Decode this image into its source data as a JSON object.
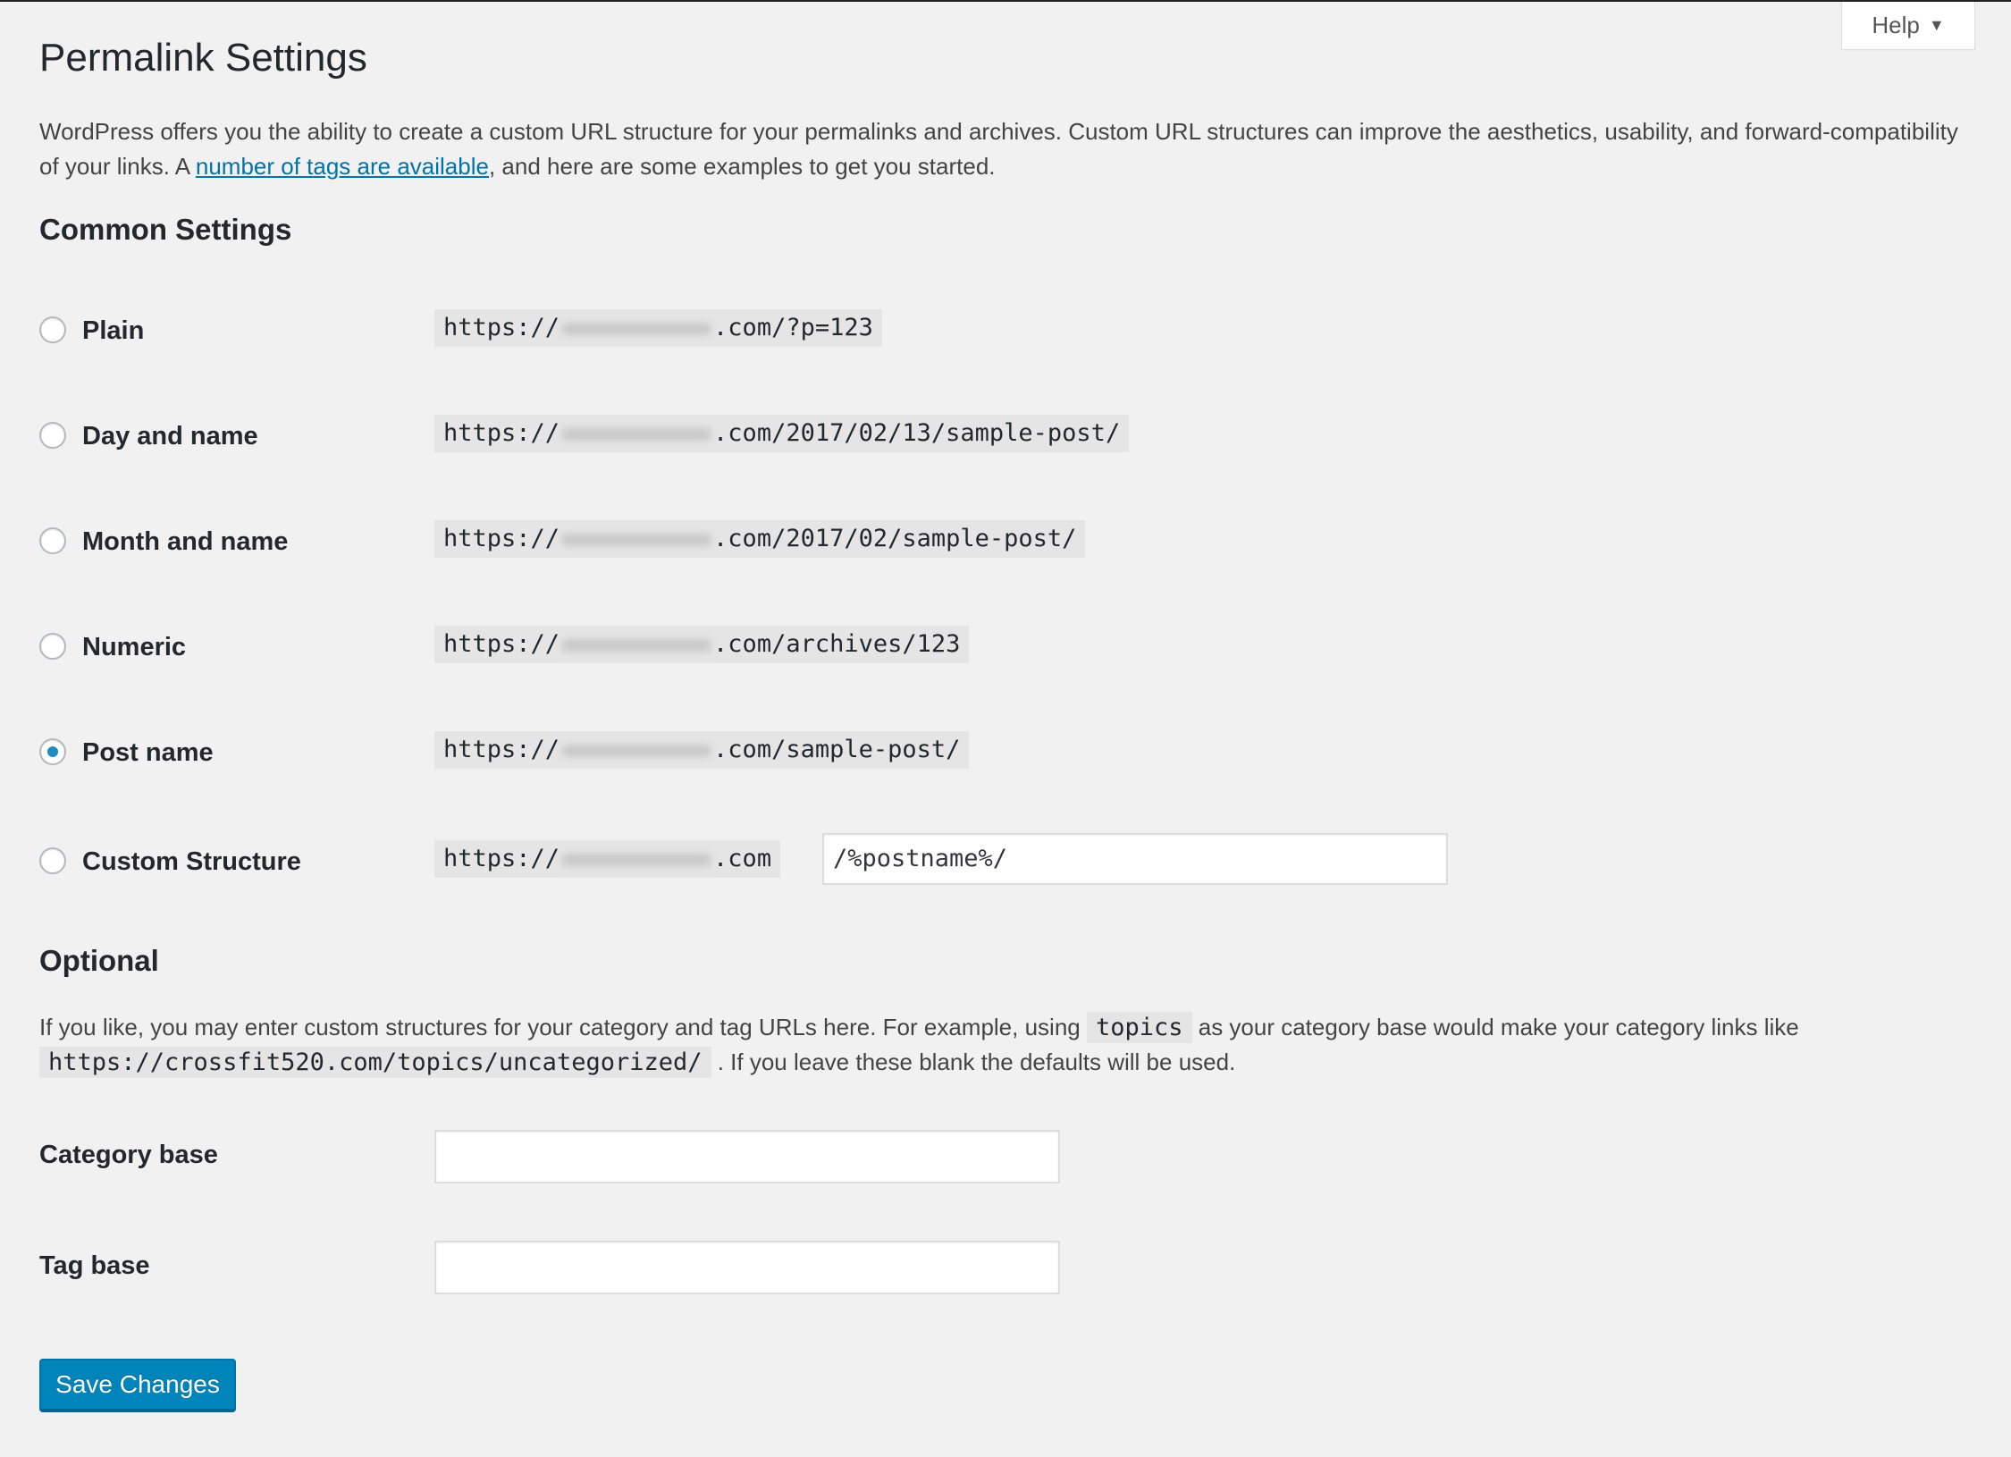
{
  "help_tab": {
    "label": "Help",
    "caret": "▼"
  },
  "page": {
    "title": "Permalink Settings",
    "intro_before_link": "WordPress offers you the ability to create a custom URL structure for your permalinks and archives. Custom URL structures can improve the aesthetics, usability, and forward-compatibility of your links. A ",
    "intro_link": "number of tags are available",
    "intro_after_link": ", and here are some examples to get you started."
  },
  "common": {
    "heading": "Common Settings",
    "url_prefix": "https://",
    "options": [
      {
        "label": "Plain",
        "suffix": ".com/?p=123",
        "checked": false
      },
      {
        "label": "Day and name",
        "suffix": ".com/2017/02/13/sample-post/",
        "checked": false
      },
      {
        "label": "Month and name",
        "suffix": ".com/2017/02/sample-post/",
        "checked": false
      },
      {
        "label": "Numeric",
        "suffix": ".com/archives/123",
        "checked": false
      },
      {
        "label": "Post name",
        "suffix": ".com/sample-post/",
        "checked": true
      },
      {
        "label": "Custom Structure",
        "suffix": ".com",
        "checked": false,
        "input_value": "/%postname%/"
      }
    ]
  },
  "optional": {
    "heading": "Optional",
    "text_1": "If you like, you may enter custom structures for your category and tag URLs here. For example, using ",
    "code_1": "topics",
    "text_2": " as your category base would make your category links like ",
    "code_2": "https://crossfit520.com/topics/uncategorized/",
    "text_3": " . If you leave these blank the defaults will be used.",
    "category_base_label": "Category base",
    "category_base_value": "",
    "tag_base_label": "Tag base",
    "tag_base_value": ""
  },
  "save_button": "Save Changes",
  "colors": {
    "primary": "#0085ba",
    "link": "#0073aa",
    "radio_dot": "#1e8cbe",
    "background": "#f1f1f1"
  }
}
